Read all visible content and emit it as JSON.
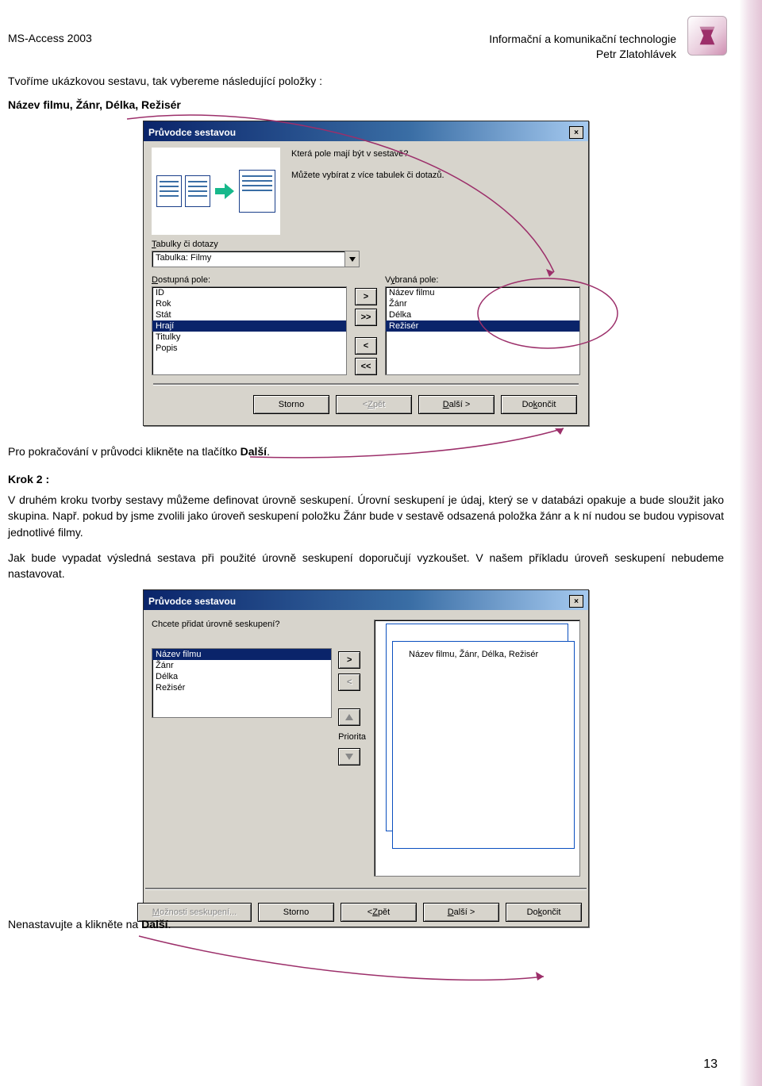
{
  "header": {
    "left": "MS-Access 2003",
    "right1": "Informační a komunikační technologie",
    "right2": "Petr Zlatohlávek"
  },
  "intro1": "Tvoříme ukázkovou sestavu, tak vybereme následující položky :",
  "intro2": "Název filmu, Žánr, Délka, Režisér",
  "wiz1": {
    "title": "Průvodce sestavou",
    "q1": "Která pole mají být v sestavě?",
    "q2": "Můžete vybírat z více tabulek či dotazů.",
    "tables_label": "Tabulky či dotazy",
    "combo": "Tabulka: Filmy",
    "avail_label": "Dostupná pole:",
    "sel_label": "Vybraná pole:",
    "available": [
      "ID",
      "Rok",
      "Stát",
      "Hrají",
      "Titulky",
      "Popis"
    ],
    "available_selected": "Hrají",
    "selected": [
      "Název filmu",
      "Žánr",
      "Délka",
      "Režisér"
    ],
    "selected_sel": "Režisér",
    "btn_gt": ">",
    "btn_gtgt": ">>",
    "btn_lt": "<",
    "btn_ltlt": "<<",
    "btn_cancel": "Storno",
    "btn_back": "< Zpět",
    "btn_next": "Další >",
    "btn_finish": "Dokončit"
  },
  "mid_text": {
    "p1_a": "Pro pokračování v průvodci klikněte na tlačítko ",
    "p1_b": "Další",
    "p1_c": ".",
    "k2": "Krok 2 :",
    "p2": "V druhém kroku tvorby sestavy můžeme definovat úrovně seskupení. Úrovní seskupení je údaj, který se v databázi opakuje a bude sloužit jako skupina. Např. pokud by jsme zvolili jako úroveň seskupení položku Žánr bude v sestavě odsazená položka žánr a k ní nudou se budou vypisovat jednotlivé filmy.",
    "p3": "Jak bude vypadat výsledná sestava při použité úrovně seskupení doporučují vyzkoušet. V našem příkladu úroveň seskupení nebudeme nastavovat."
  },
  "wiz2": {
    "title": "Průvodce sestavou",
    "q": "Chcete přidat úrovně seskupení?",
    "fields": [
      "Název filmu",
      "Žánr",
      "Délka",
      "Režisér"
    ],
    "fields_sel": "Název filmu",
    "preview_label": "Název filmu, Žánr, Délka, Režisér",
    "priority": "Priorita",
    "btn_options": "Možnosti seskupení...",
    "btn_cancel": "Storno",
    "btn_back": "< Zpět",
    "btn_next": "Další >",
    "btn_finish": "Dokončit"
  },
  "outro_a": "Nenastavujte a klikněte na ",
  "outro_b": "Další",
  "outro_c": ".",
  "page_num": "13"
}
